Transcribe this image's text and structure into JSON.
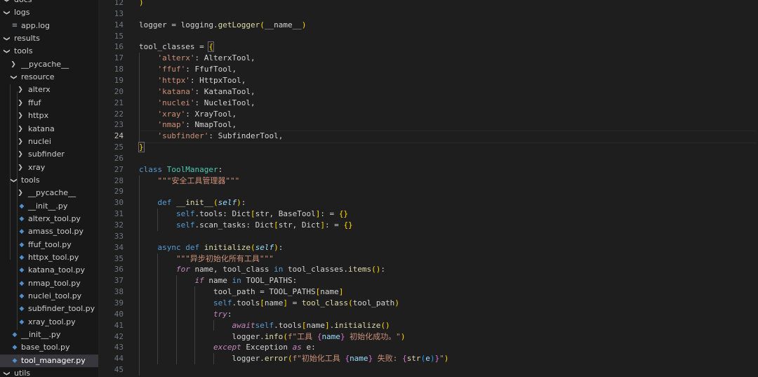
{
  "explorer": {
    "rows": [
      {
        "label": "docs",
        "kind": "folder",
        "open": true,
        "indent": 0
      },
      {
        "label": "logs",
        "kind": "folder",
        "open": true,
        "indent": 0
      },
      {
        "label": "app.log",
        "kind": "log",
        "indent": 1
      },
      {
        "label": "results",
        "kind": "folder",
        "open": true,
        "indent": 0
      },
      {
        "label": "tools",
        "kind": "folder",
        "open": true,
        "indent": 0
      },
      {
        "label": "__pycache__",
        "kind": "folder",
        "open": false,
        "indent": 1
      },
      {
        "label": "resource",
        "kind": "folder",
        "open": true,
        "indent": 1
      },
      {
        "label": "alterx",
        "kind": "folder",
        "open": false,
        "indent": 2
      },
      {
        "label": "ffuf",
        "kind": "folder",
        "open": false,
        "indent": 2
      },
      {
        "label": "httpx",
        "kind": "folder",
        "open": false,
        "indent": 2
      },
      {
        "label": "katana",
        "kind": "folder",
        "open": false,
        "indent": 2
      },
      {
        "label": "nuclei",
        "kind": "folder",
        "open": false,
        "indent": 2
      },
      {
        "label": "subfinder",
        "kind": "folder",
        "open": false,
        "indent": 2
      },
      {
        "label": "xray",
        "kind": "folder",
        "open": false,
        "indent": 2
      },
      {
        "label": "tools",
        "kind": "folder",
        "open": true,
        "indent": 1
      },
      {
        "label": "__pycache__",
        "kind": "folder",
        "open": false,
        "indent": 2
      },
      {
        "label": "__init__.py",
        "kind": "py",
        "indent": 2
      },
      {
        "label": "alterx_tool.py",
        "kind": "py",
        "indent": 2
      },
      {
        "label": "amass_tool.py",
        "kind": "py",
        "indent": 2
      },
      {
        "label": "ffuf_tool.py",
        "kind": "py",
        "indent": 2
      },
      {
        "label": "httpx_tool.py",
        "kind": "py",
        "indent": 2
      },
      {
        "label": "katana_tool.py",
        "kind": "py",
        "indent": 2
      },
      {
        "label": "nmap_tool.py",
        "kind": "py",
        "indent": 2
      },
      {
        "label": "nuclei_tool.py",
        "kind": "py",
        "indent": 2
      },
      {
        "label": "subfinder_tool.py",
        "kind": "py",
        "indent": 2
      },
      {
        "label": "xray_tool.py",
        "kind": "py",
        "indent": 2
      },
      {
        "label": "__init__.py",
        "kind": "py",
        "indent": 1
      },
      {
        "label": "base_tool.py",
        "kind": "py",
        "indent": 1
      },
      {
        "label": "tool_manager.py",
        "kind": "py",
        "indent": 1,
        "active": true
      },
      {
        "label": "utils",
        "kind": "folder",
        "open": true,
        "indent": 0
      }
    ]
  },
  "editor": {
    "current_line": 24,
    "lines": [
      {
        "n": 12,
        "t": [
          [
            "br1",
            ")"
          ]
        ]
      },
      {
        "n": 13,
        "t": []
      },
      {
        "n": 14,
        "t": [
          [
            "",
            "logger = logging."
          ],
          [
            "fn",
            "getLogger"
          ],
          [
            "br1",
            "("
          ],
          [
            "",
            "__name__"
          ],
          [
            "br1",
            ")"
          ]
        ]
      },
      {
        "n": 15,
        "t": []
      },
      {
        "n": 16,
        "t": [
          [
            "",
            "tool_classes = "
          ],
          [
            "br1 bracket-hl",
            "{"
          ]
        ]
      },
      {
        "n": 17,
        "t": [
          [
            "",
            "    "
          ],
          [
            "str",
            "'alterx'"
          ],
          [
            "",
            ": AlterxTool,"
          ]
        ]
      },
      {
        "n": 18,
        "t": [
          [
            "",
            "    "
          ],
          [
            "str",
            "'ffuf'"
          ],
          [
            "",
            ": FfufTool,"
          ]
        ]
      },
      {
        "n": 19,
        "t": [
          [
            "",
            "    "
          ],
          [
            "str",
            "'httpx'"
          ],
          [
            "",
            ": HttpxTool,"
          ]
        ]
      },
      {
        "n": 20,
        "t": [
          [
            "",
            "    "
          ],
          [
            "str",
            "'katana'"
          ],
          [
            "",
            ": KatanaTool,"
          ]
        ]
      },
      {
        "n": 21,
        "t": [
          [
            "",
            "    "
          ],
          [
            "str",
            "'nuclei'"
          ],
          [
            "",
            ": NucleiTool,"
          ]
        ]
      },
      {
        "n": 22,
        "t": [
          [
            "",
            "    "
          ],
          [
            "str",
            "'xray'"
          ],
          [
            "",
            ": XrayTool,"
          ]
        ]
      },
      {
        "n": 23,
        "t": [
          [
            "",
            "    "
          ],
          [
            "str",
            "'nmap'"
          ],
          [
            "",
            ": NmapTool,"
          ]
        ]
      },
      {
        "n": 24,
        "t": [
          [
            "",
            "    "
          ],
          [
            "str",
            "'subfinder'"
          ],
          [
            "",
            ": SubfinderTool,"
          ]
        ]
      },
      {
        "n": 25,
        "t": [
          [
            "br1 bracket-hl",
            "}"
          ]
        ]
      },
      {
        "n": 26,
        "t": []
      },
      {
        "n": 27,
        "t": [
          [
            "kw",
            "class "
          ],
          [
            "cls",
            "ToolManager"
          ],
          [
            "",
            ":"
          ]
        ]
      },
      {
        "n": 28,
        "t": [
          [
            "",
            "    "
          ],
          [
            "str",
            "\"\"\"安全工具管理器\"\"\""
          ]
        ]
      },
      {
        "n": 29,
        "t": []
      },
      {
        "n": 30,
        "t": [
          [
            "",
            "    "
          ],
          [
            "kw",
            "def "
          ],
          [
            "fn",
            "__init__"
          ],
          [
            "br1",
            "("
          ],
          [
            "par",
            "self"
          ],
          [
            "br1",
            ")"
          ],
          [
            "",
            ":"
          ]
        ]
      },
      {
        "n": 31,
        "t": [
          [
            "",
            "        "
          ],
          [
            "slf",
            "self"
          ],
          [
            "",
            ".tools: Dict"
          ],
          [
            "br1",
            "["
          ],
          [
            "",
            "str, BaseTool"
          ],
          [
            "br1",
            "]"
          ],
          [
            "",
            ": = "
          ],
          [
            "br1",
            "{}"
          ]
        ]
      },
      {
        "n": 32,
        "t": [
          [
            "",
            "        "
          ],
          [
            "slf",
            "self"
          ],
          [
            "",
            ".scan_tasks: Dict"
          ],
          [
            "br1",
            "["
          ],
          [
            "",
            "str, Dict"
          ],
          [
            "br1",
            "]"
          ],
          [
            "",
            ": = "
          ],
          [
            "br1",
            "{}"
          ]
        ]
      },
      {
        "n": 33,
        "t": []
      },
      {
        "n": 34,
        "t": [
          [
            "",
            "    "
          ],
          [
            "kw",
            "async def "
          ],
          [
            "fn",
            "initialize"
          ],
          [
            "br1",
            "("
          ],
          [
            "par",
            "self"
          ],
          [
            "br1",
            ")"
          ],
          [
            "",
            ":"
          ]
        ]
      },
      {
        "n": 35,
        "t": [
          [
            "",
            "        "
          ],
          [
            "str",
            "\"\"\"异步初始化所有工具\"\"\""
          ]
        ]
      },
      {
        "n": 36,
        "t": [
          [
            "",
            "        "
          ],
          [
            "kwc",
            "for"
          ],
          [
            "",
            " name, tool_class "
          ],
          [
            "kw",
            "in"
          ],
          [
            "",
            " tool_classes."
          ],
          [
            "fn",
            "items"
          ],
          [
            "br1",
            "()"
          ],
          [
            "",
            ":"
          ]
        ]
      },
      {
        "n": 37,
        "t": [
          [
            "",
            "            "
          ],
          [
            "kwc",
            "if"
          ],
          [
            "",
            " name "
          ],
          [
            "kw",
            "in"
          ],
          [
            "",
            " TOOL_PATHS:"
          ]
        ]
      },
      {
        "n": 38,
        "t": [
          [
            "",
            "                tool_path = TOOL_PATHS"
          ],
          [
            "br1",
            "["
          ],
          [
            "",
            "name"
          ],
          [
            "br1",
            "]"
          ]
        ]
      },
      {
        "n": 39,
        "t": [
          [
            "",
            "                "
          ],
          [
            "slf",
            "self"
          ],
          [
            "",
            ".tools"
          ],
          [
            "br1",
            "["
          ],
          [
            "",
            "name"
          ],
          [
            "br1",
            "]"
          ],
          [
            "",
            " = "
          ],
          [
            "fn",
            "tool_class"
          ],
          [
            "br1",
            "("
          ],
          [
            "",
            "tool_path"
          ],
          [
            "br1",
            ")"
          ]
        ]
      },
      {
        "n": 40,
        "t": [
          [
            "",
            "                "
          ],
          [
            "kwc",
            "try"
          ],
          [
            "",
            ":"
          ]
        ]
      },
      {
        "n": 41,
        "t": [
          [
            "",
            "                    "
          ],
          [
            "kwc",
            "await"
          ],
          [
            " ",
            ""
          ],
          [
            "slf",
            "self"
          ],
          [
            "",
            ".tools"
          ],
          [
            "br1",
            "["
          ],
          [
            "",
            "name"
          ],
          [
            "br1",
            "]"
          ],
          [
            "",
            "."
          ],
          [
            "fn",
            "initialize"
          ],
          [
            "br1",
            "()"
          ]
        ]
      },
      {
        "n": 42,
        "t": [
          [
            "",
            "                    logger."
          ],
          [
            "fn",
            "info"
          ],
          [
            "br1",
            "("
          ],
          [
            "str",
            "f\"工具 "
          ],
          [
            "br2",
            "{"
          ],
          [
            "var",
            "name"
          ],
          [
            "br2",
            "}"
          ],
          [
            "str",
            " 初始化成功。\""
          ],
          [
            "br1",
            ")"
          ]
        ]
      },
      {
        "n": 43,
        "t": [
          [
            "",
            "                "
          ],
          [
            "kwc",
            "except"
          ],
          [
            "",
            " Exception "
          ],
          [
            "kwc",
            "as"
          ],
          [
            "",
            " e:"
          ]
        ]
      },
      {
        "n": 44,
        "t": [
          [
            "",
            "                    logger."
          ],
          [
            "fn",
            "error"
          ],
          [
            "br1",
            "("
          ],
          [
            "str",
            "f\"初始化工具 "
          ],
          [
            "br2",
            "{"
          ],
          [
            "var",
            "name"
          ],
          [
            "br2",
            "}"
          ],
          [
            "str",
            " 失败: "
          ],
          [
            "br2",
            "{"
          ],
          [
            "fn",
            "str"
          ],
          [
            "br3",
            "("
          ],
          [
            "var",
            "e"
          ],
          [
            "br3",
            ")"
          ],
          [
            "br2",
            "}"
          ],
          [
            "str",
            "\""
          ],
          [
            "br1",
            ")"
          ]
        ]
      },
      {
        "n": 45,
        "t": []
      }
    ]
  }
}
